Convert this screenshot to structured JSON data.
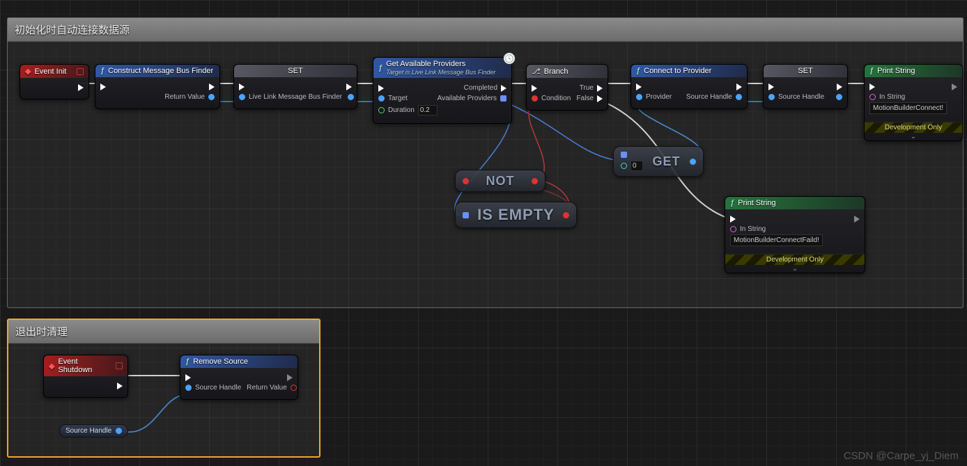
{
  "comments": {
    "c1_title": "初始化时自动连接数据源",
    "c2_title": "退出时清理"
  },
  "nodes": {
    "eventInit": {
      "title": "Event Init"
    },
    "construct": {
      "title": "Construct Message Bus Finder",
      "out_val": "Return Value"
    },
    "set1": {
      "title": "SET",
      "in_val": "Live Link Message Bus Finder"
    },
    "getProv": {
      "title": "Get Available Providers",
      "subtitle": "Target is Live Link Message Bus Finder",
      "in_target": "Target",
      "in_duration": "Duration",
      "in_duration_val": "0.2",
      "out_completed": "Completed",
      "out_providers": "Available Providers"
    },
    "branch": {
      "title": "Branch",
      "in_cond": "Condition",
      "out_true": "True",
      "out_false": "False"
    },
    "connect": {
      "title": "Connect to Provider",
      "in_prov": "Provider",
      "out_handle": "Source Handle"
    },
    "set2": {
      "title": "SET",
      "out_val": "Source Handle"
    },
    "print1": {
      "title": "Print String",
      "in_str": "In String",
      "in_str_val": "MotionBuilderConnect!",
      "dev": "Development Only"
    },
    "print2": {
      "title": "Print String",
      "in_str": "In String",
      "in_str_val": "MotionBuilderConnectFaild!",
      "dev": "Development Only"
    },
    "not": {
      "title": "NOT"
    },
    "isempty": {
      "title": "IS EMPTY"
    },
    "get": {
      "title": "GET",
      "idx": "0"
    },
    "eventShutdown": {
      "title": "Event Shutdown"
    },
    "removeSrc": {
      "title": "Remove Source",
      "in_handle": "Source Handle",
      "out_val": "Return Value"
    },
    "varHandle": {
      "title": "Source Handle"
    }
  },
  "watermark": "CSDN @Carpe_yj_Diem"
}
